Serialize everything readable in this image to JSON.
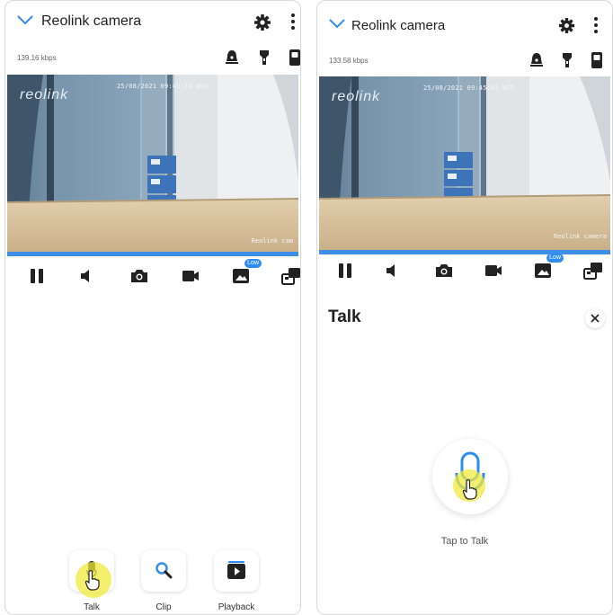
{
  "left": {
    "title": "Reolink camera",
    "bitrate": "139.16 kbps",
    "video": {
      "timestamp": "25/08/2021 09:45:14 WED",
      "logo": "reolink",
      "watermark": "Reolink cam"
    },
    "quality_badge": "Low",
    "actions": [
      {
        "label": "Talk",
        "icon": "mic-icon"
      },
      {
        "label": "Clip",
        "icon": "search-icon"
      },
      {
        "label": "Playback",
        "icon": "playback-icon"
      }
    ]
  },
  "right": {
    "title": "Reolink camera",
    "bitrate": "133.58 kbps",
    "video": {
      "timestamp": "25/08/2021 09:45:03 WED",
      "logo": "reolink",
      "watermark": "Reolink camera"
    },
    "quality_badge": "Low",
    "talk_panel": {
      "title": "Talk",
      "hint": "Tap to Talk"
    }
  },
  "colors": {
    "accent": "#2f8cf0",
    "progress": "#3d8ee8",
    "highlight": "#f0ea3c"
  }
}
